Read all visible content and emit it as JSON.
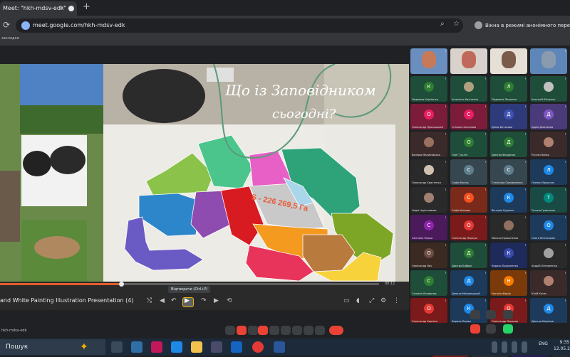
{
  "browser": {
    "tab_title": "Meet: \"hkh-mdsv-edk\"",
    "tab_close": "✕",
    "new_tab": "+",
    "url": "meet.google.com/hkh-mdsv-edk",
    "incognito_text": "Вікна в режимі анонімного перегляду",
    "bookmarks_label": "закладки"
  },
  "slide": {
    "title_line1": "Що із Заповідником",
    "title_line2": "сьогодні?",
    "map_label": "S - 226 269,5 Га"
  },
  "player": {
    "progress_percent": 32,
    "time_right": "00:11",
    "presentation_title": "and White Painting Illustration Presentation (4)",
    "tooltip": "Відтворити (Ctrl+P)"
  },
  "participants": [
    {
      "name": "",
      "type": "video",
      "color": "#c77a5a",
      "bg": "#6a8fbf"
    },
    {
      "name": "",
      "type": "video",
      "color": "#c0685a",
      "bg": "#d9d2cc"
    },
    {
      "name": "",
      "type": "video",
      "color": "#7a5a4a",
      "bg": "#e6dfd6"
    },
    {
      "name": "",
      "type": "video",
      "color": "#8a9bb0",
      "bg": "#5f86b8"
    },
    {
      "name": "Людмила Корнієнко",
      "type": "initial",
      "initial": "К",
      "color": "#2e7d32",
      "bg": "#1e4d3a"
    },
    {
      "name": "Анжеліка Кисіленко",
      "type": "photo",
      "initial": "",
      "color": "#b0a080",
      "bg": "#1e4d3a"
    },
    {
      "name": "Людмила Лещенко",
      "type": "initial",
      "initial": "Л",
      "color": "#2e7d32",
      "bg": "#1e4d3a"
    },
    {
      "name": "Анатолій Ющенко",
      "type": "photo",
      "initial": "",
      "color": "#c0c0c0",
      "bg": "#1e4d3a"
    },
    {
      "name": "Олександр Прокоцький",
      "type": "initial",
      "initial": "О",
      "color": "#e91e63",
      "bg": "#7a1c3a"
    },
    {
      "name": "Сніжана Кононова",
      "type": "initial",
      "initial": "С",
      "color": "#e91e63",
      "bg": "#7a1c3a"
    },
    {
      "name": "Діана Фетисова",
      "type": "initial",
      "initial": "Д",
      "color": "#3f51b5",
      "bg": "#2e3a7a"
    },
    {
      "name": "Дарія Дмитрієва",
      "type": "initial",
      "initial": "Д",
      "color": "#7e57c2",
      "bg": "#4a3a7a"
    },
    {
      "name": "Валерія Малиновська",
      "type": "photo",
      "initial": "",
      "color": "#9a7060",
      "bg": "#3a2a2a"
    },
    {
      "name": "Олег Тухлін",
      "type": "initial",
      "initial": "О",
      "color": "#2e7d32",
      "bg": "#1e4d3a"
    },
    {
      "name": "Дмитро Федорчак",
      "type": "initial",
      "initial": "Д",
      "color": "#2e7d32",
      "bg": "#1e4d3a"
    },
    {
      "name": "Руслан Вайко",
      "type": "photo",
      "initial": "",
      "color": "#b08070",
      "bg": "#3a2a2a"
    },
    {
      "name": "Олександр Христенко",
      "type": "photo",
      "initial": "",
      "color": "#d0c0b0",
      "bg": "#2a2a2a"
    },
    {
      "name": "Софія Кисіль",
      "type": "initial",
      "initial": "С",
      "color": "#607d8b",
      "bg": "#37474f"
    },
    {
      "name": "Станіслав Саливоненко",
      "type": "initial",
      "initial": "С",
      "color": "#607d8b",
      "bg": "#37474f"
    },
    {
      "name": "Леонід Мірошник",
      "type": "initial",
      "initial": "Л",
      "color": "#1e88e5",
      "bg": "#1d3a5a"
    },
    {
      "name": "Надія Нурісламова",
      "type": "photo",
      "initial": "",
      "color": "#a08070",
      "bg": "#2a2a2a"
    },
    {
      "name": "Софія Клінова",
      "type": "initial",
      "initial": "С",
      "color": "#f4511e",
      "bg": "#7a2a1a"
    },
    {
      "name": "Вікторія Руденко",
      "type": "initial",
      "initial": "К",
      "color": "#1e88e5",
      "bg": "#1d3a5a"
    },
    {
      "name": "Тетяна Гравченко",
      "type": "initial",
      "initial": "Т",
      "color": "#00897b",
      "bg": "#1a4a44"
    },
    {
      "name": "Світлана Рожко",
      "type": "initial",
      "initial": "С",
      "color": "#8e24aa",
      "bg": "#4a1a5a"
    },
    {
      "name": "Олександр Маркуш",
      "type": "initial",
      "initial": "О",
      "color": "#e53935",
      "bg": "#7a1a1a"
    },
    {
      "name": "Микола Прокопенко",
      "type": "photo",
      "initial": "",
      "color": "#907060",
      "bg": "#2a2a2a"
    },
    {
      "name": "Ольга Вітенський",
      "type": "initial",
      "initial": "О",
      "color": "#1e88e5",
      "bg": "#1d3a5a"
    },
    {
      "name": "Олександр Нич",
      "type": "initial",
      "initial": "О",
      "color": "#6d4c41",
      "bg": "#3a2a22"
    },
    {
      "name": "Дмитро Бобрик",
      "type": "initial",
      "initial": "Д",
      "color": "#2e7d32",
      "bg": "#1e4d3a"
    },
    {
      "name": "Кирило Прокопенко",
      "type": "initial",
      "initial": "К",
      "color": "#3949ab",
      "bg": "#1d2a5a"
    },
    {
      "name": "Андрій Литвиненко",
      "type": "photo",
      "initial": "",
      "color": "#a0a0a0",
      "bg": "#2a2a2a"
    },
    {
      "name": "Соломія Лахманюк",
      "type": "initial",
      "initial": "С",
      "color": "#2e7d32",
      "bg": "#1e4d3a"
    },
    {
      "name": "Данило Маковецький",
      "type": "initial",
      "initial": "Д",
      "color": "#1e88e5",
      "bg": "#1d3a5a"
    },
    {
      "name": "Наталія Фаріш",
      "type": "initial",
      "initial": "Н",
      "color": "#f57c00",
      "bg": "#7a3a0a"
    },
    {
      "name": "Юлій Котик",
      "type": "photo",
      "initial": "",
      "color": "#b08070",
      "bg": "#3a2a2a"
    },
    {
      "name": "Олександр Корніко",
      "type": "initial",
      "initial": "О",
      "color": "#e53935",
      "bg": "#7a1a1a"
    },
    {
      "name": "Кирило Ляшко",
      "type": "initial",
      "initial": "К",
      "color": "#1e88e5",
      "bg": "#1d3a5a"
    },
    {
      "name": "Олександр Морозов",
      "type": "initial",
      "initial": "О",
      "color": "#e53935",
      "bg": "#7a1a1a"
    },
    {
      "name": "Дмитро Морозов",
      "type": "initial",
      "initial": "Д",
      "color": "#1e88e5",
      "bg": "#1d3a5a"
    },
    {
      "name": "Христина Кирилюкова",
      "type": "initial",
      "initial": "К",
      "color": "#e53935",
      "bg": "#7a1a1a"
    },
    {
      "name": "",
      "type": "initial",
      "initial": "",
      "color": "#3c4043",
      "bg": "#2a2e33"
    },
    {
      "name": "Ар Балабай",
      "type": "initial",
      "initial": "АБ",
      "color": "#5e35b1",
      "bg": "#2a1a5a"
    },
    {
      "name": "Юрій Гребенко",
      "type": "photo",
      "initial": "",
      "color": "#c0b090",
      "bg": "#2a2a2a"
    }
  ],
  "controls": {
    "left_label": "hkh-mdsv-edk"
  },
  "taskbar": {
    "search_text": "Пошук",
    "language": "ENG",
    "time": "9:35",
    "date": "12.05.2024"
  }
}
